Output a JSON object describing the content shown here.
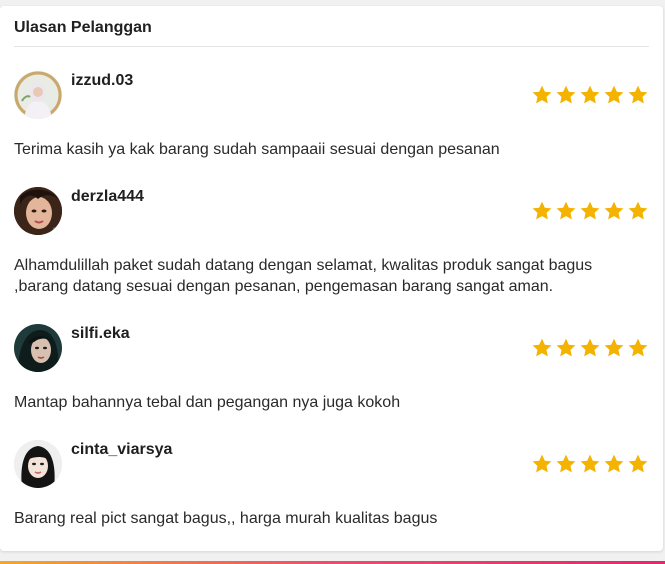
{
  "section": {
    "title": "Ulasan Pelanggan"
  },
  "reviews": [
    {
      "username": "izzud.03",
      "rating": 5,
      "comment": "Terima kasih ya kak barang sudah sampaaii sesuai dengan pesanan"
    },
    {
      "username": "derzla444",
      "rating": 5,
      "comment": "Alhamdulillah paket sudah datang dengan selamat, kwalitas produk sangat bagus ,barang datang sesuai dengan pesanan, pengemasan barang sangat aman."
    },
    {
      "username": "silfi.eka",
      "rating": 5,
      "comment": "Mantap bahannya tebal dan pegangan nya juga kokoh"
    },
    {
      "username": "cinta_viarsya",
      "rating": 5,
      "comment": "Barang real pict sangat bagus,, harga murah kualitas bagus"
    }
  ],
  "colors": {
    "star": "#f5b301",
    "accent_gradient": [
      "#f6a623",
      "#f04a6b",
      "#e6266f"
    ]
  }
}
